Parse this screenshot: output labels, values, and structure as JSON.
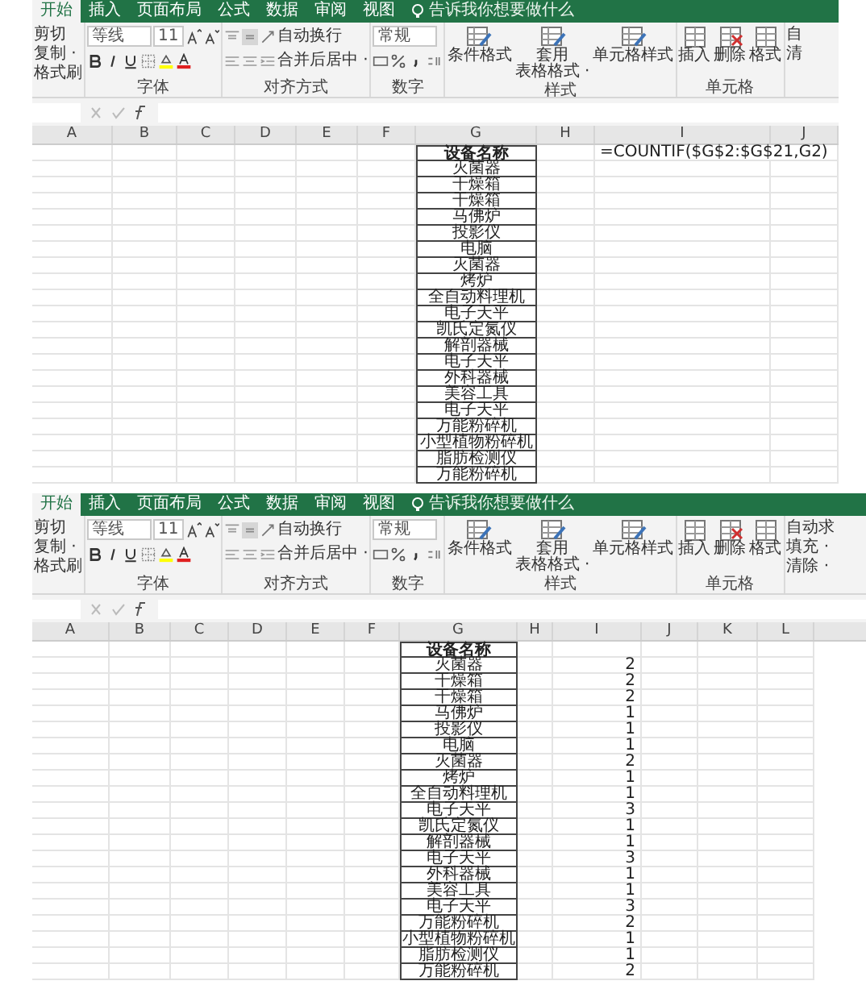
{
  "panes": [
    {
      "tabs": [
        {
          "label": "开始",
          "selected": true
        },
        {
          "label": "插入",
          "selected": false
        },
        {
          "label": "页面布局",
          "selected": false
        },
        {
          "label": "公式",
          "selected": false
        },
        {
          "label": "数据",
          "selected": false
        },
        {
          "label": "审阅",
          "selected": false
        },
        {
          "label": "视图",
          "selected": false
        }
      ],
      "tell_me": "告诉我你想要做什么",
      "ribbon": {
        "clipboard": [
          "剪切",
          "复制 ·",
          "格式刷"
        ],
        "font_name": "等线",
        "font_size": "11",
        "font_group": "字体",
        "wrap": "自动换行",
        "merge": "合并后居中 ·",
        "align_group": "对齐方式",
        "number_format": "常规",
        "number_group": "数字",
        "styles": [
          [
            "条件格式"
          ],
          [
            "套用",
            "表格格式 ·"
          ],
          [
            "单元格样式"
          ]
        ],
        "styles_group": "样式",
        "cells": [
          "插入",
          "删除",
          "格式"
        ],
        "cells_group": "单元格",
        "editing": [
          "自",
          "清"
        ]
      },
      "columns": [
        "A",
        "B",
        "C",
        "D",
        "E",
        "F",
        "G",
        "H",
        "I",
        "J"
      ],
      "rows": [
        {
          "g": "设备名称",
          "i": "=COUNTIF($G$2:$G$21,G2)"
        },
        {
          "g": "灭菌器"
        },
        {
          "g": "干燥箱"
        },
        {
          "g": "干燥箱"
        },
        {
          "g": "马佛炉"
        },
        {
          "g": "投影仪"
        },
        {
          "g": "电脑"
        },
        {
          "g": "灭菌器"
        },
        {
          "g": "烤炉"
        },
        {
          "g": "全自动料理机"
        },
        {
          "g": "电子天平"
        },
        {
          "g": "凯氏定氮仪"
        },
        {
          "g": "解剖器械"
        },
        {
          "g": "电子天平"
        },
        {
          "g": "外科器械"
        },
        {
          "g": "美容工具"
        },
        {
          "g": "电子天平"
        },
        {
          "g": "万能粉碎机"
        },
        {
          "g": "小型植物粉碎机"
        },
        {
          "g": "脂肪检测仪"
        },
        {
          "g": "万能粉碎机"
        }
      ]
    },
    {
      "tabs": [
        {
          "label": "开始",
          "selected": true
        },
        {
          "label": "插入",
          "selected": false
        },
        {
          "label": "页面布局",
          "selected": false
        },
        {
          "label": "公式",
          "selected": false
        },
        {
          "label": "数据",
          "selected": false
        },
        {
          "label": "审阅",
          "selected": false
        },
        {
          "label": "视图",
          "selected": false
        }
      ],
      "tell_me": "告诉我你想要做什么",
      "ribbon": {
        "clipboard": [
          "剪切",
          "复制 ·",
          "格式刷"
        ],
        "font_name": "等线",
        "font_size": "11",
        "font_group": "字体",
        "wrap": "自动换行",
        "merge": "合并后居中 ·",
        "align_group": "对齐方式",
        "number_format": "常规",
        "number_group": "数字",
        "styles": [
          [
            "条件格式"
          ],
          [
            "套用",
            "表格格式 ·"
          ],
          [
            "单元格样式"
          ]
        ],
        "styles_group": "样式",
        "cells": [
          "插入",
          "删除",
          "格式"
        ],
        "cells_group": "单元格",
        "editing": [
          "自动求",
          "填充 ·",
          "清除 ·"
        ]
      },
      "columns": [
        "A",
        "B",
        "C",
        "D",
        "E",
        "F",
        "G",
        "H",
        "I",
        "J",
        "K",
        "L"
      ],
      "rows": [
        {
          "g": "设备名称"
        },
        {
          "g": "灭菌器",
          "i": "2"
        },
        {
          "g": "干燥箱",
          "i": "2"
        },
        {
          "g": "干燥箱",
          "i": "2"
        },
        {
          "g": "马佛炉",
          "i": "1"
        },
        {
          "g": "投影仪",
          "i": "1"
        },
        {
          "g": "电脑",
          "i": "1"
        },
        {
          "g": "灭菌器",
          "i": "2"
        },
        {
          "g": "烤炉",
          "i": "1"
        },
        {
          "g": "全自动料理机",
          "i": "1"
        },
        {
          "g": "电子天平",
          "i": "3"
        },
        {
          "g": "凯氏定氮仪",
          "i": "1"
        },
        {
          "g": "解剖器械",
          "i": "1"
        },
        {
          "g": "电子天平",
          "i": "3"
        },
        {
          "g": "外科器械",
          "i": "1"
        },
        {
          "g": "美容工具",
          "i": "1"
        },
        {
          "g": "电子天平",
          "i": "3"
        },
        {
          "g": "万能粉碎机",
          "i": "2"
        },
        {
          "g": "小型植物粉碎机",
          "i": "1"
        },
        {
          "g": "脂肪检测仪",
          "i": "1"
        },
        {
          "g": "万能粉碎机",
          "i": "2"
        }
      ]
    }
  ]
}
